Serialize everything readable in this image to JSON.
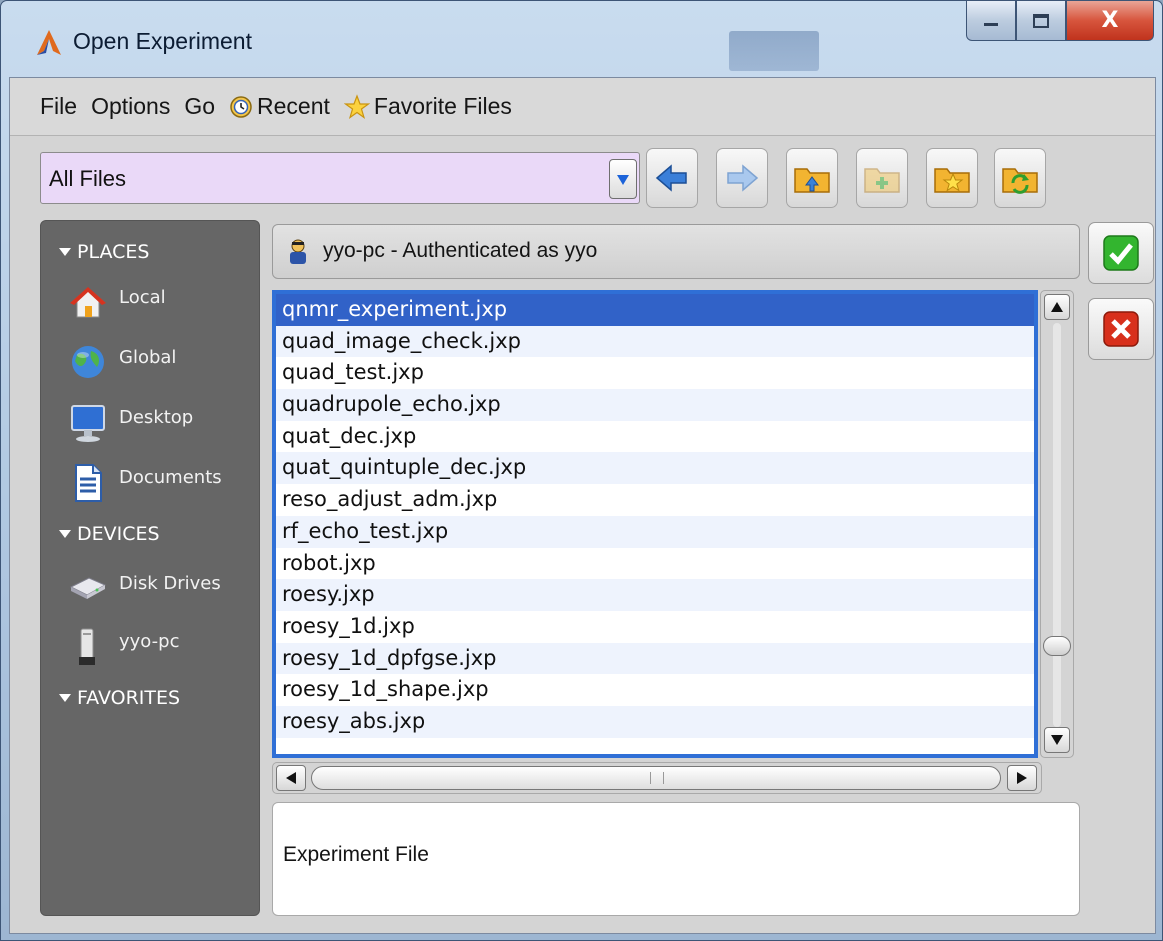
{
  "window": {
    "title": "Open Experiment",
    "close_glyph": "X"
  },
  "menubar": {
    "items": [
      "File",
      "Options",
      "Go",
      "Recent",
      "Favorite Files"
    ]
  },
  "toolbar": {
    "filter_value": "All Files"
  },
  "places": {
    "headings": [
      "PLACES",
      "DEVICES",
      "FAVORITES"
    ],
    "places_items": [
      "Local",
      "Global",
      "Desktop",
      "Documents"
    ],
    "device_items": [
      "Disk Drives",
      "yyo-pc"
    ]
  },
  "host": {
    "text": "yyo-pc - Authenticated as yyo"
  },
  "files": {
    "selected_index": 0,
    "items": [
      "qnmr_experiment.jxp",
      "quad_image_check.jxp",
      "quad_test.jxp",
      "quadrupole_echo.jxp",
      "quat_dec.jxp",
      "quat_quintuple_dec.jxp",
      "reso_adjust_adm.jxp",
      "rf_echo_test.jxp",
      "robot.jxp",
      "roesy.jxp",
      "roesy_1d.jxp",
      "roesy_1d_dpfgse.jxp",
      "roesy_1d_shape.jxp",
      "roesy_abs.jxp"
    ]
  },
  "description": {
    "text": "Experiment File"
  },
  "colors": {
    "selection": "#3162c8",
    "filter_bg": "#ead9f8",
    "places_bg": "#666666",
    "ok_green": "#33b52f",
    "cancel_red": "#d8301c"
  }
}
